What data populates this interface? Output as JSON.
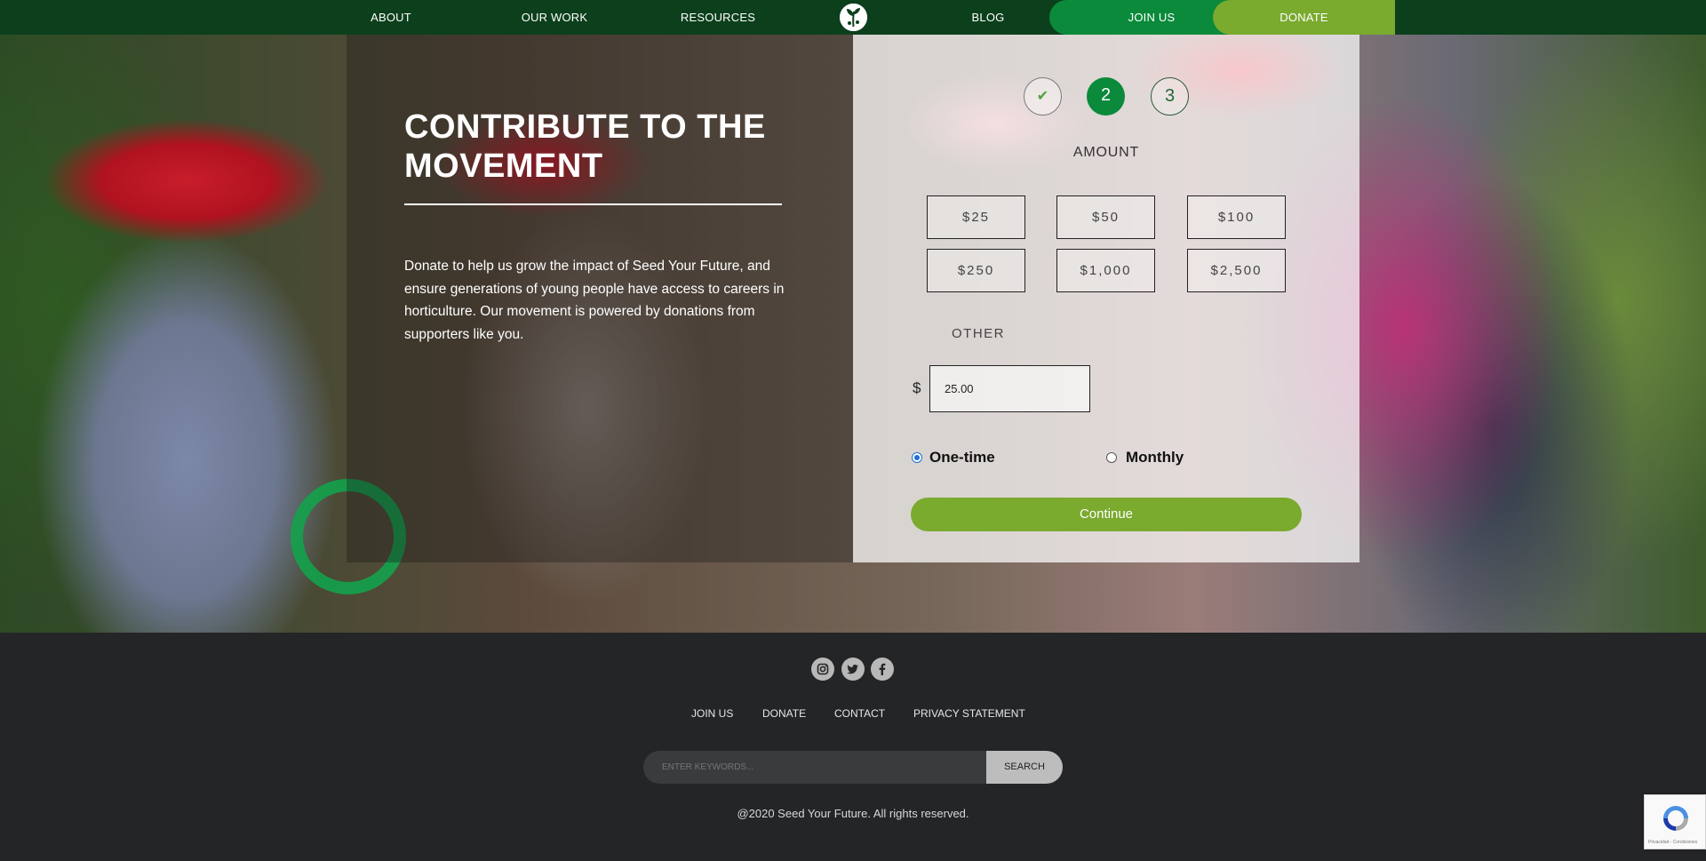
{
  "nav": {
    "about": "ABOUT",
    "our_work": "OUR WORK",
    "resources": "RESOURCES",
    "blog": "BLOG",
    "join_us": "JOIN US",
    "donate": "DONATE",
    "logo_icon": "seed-your-future-logo"
  },
  "hero": {
    "title": "CONTRIBUTE TO THE MOVEMENT",
    "description": "Donate to help us grow the impact of Seed Your Future, and ensure generations of young people have access to careers in horticulture. Our movement is powered by donations from supporters like you."
  },
  "form": {
    "steps": [
      {
        "label": "✔",
        "state": "complete"
      },
      {
        "label": "2",
        "state": "active"
      },
      {
        "label": "3",
        "state": "upcoming"
      }
    ],
    "amount_label": "AMOUNT",
    "amounts": [
      "$25",
      "$50",
      "$100",
      "$250",
      "$1,000",
      "$2,500"
    ],
    "other_label": "OTHER",
    "currency_symbol": "$",
    "other_value": "25.00",
    "frequency": [
      {
        "label": "One-time",
        "selected": true
      },
      {
        "label": "Monthly",
        "selected": false
      }
    ],
    "continue_label": "Continue"
  },
  "footer": {
    "social": [
      "instagram-icon",
      "twitter-icon",
      "facebook-icon"
    ],
    "links": [
      "JOIN US",
      "DONATE",
      "CONTACT",
      "PRIVACY STATEMENT"
    ],
    "search_placeholder": "ENTER KEYWORDS...",
    "search_button": "SEARCH",
    "copyright": "@2020 Seed Your Future. All rights reserved."
  },
  "recaptcha": {
    "text": "Privacidad - Condiciones"
  },
  "colors": {
    "nav_bg": "#0c3f1c",
    "brand_green": "#0a8a3a",
    "accent_lime": "#7aaa2e",
    "footer_bg": "#242527"
  }
}
